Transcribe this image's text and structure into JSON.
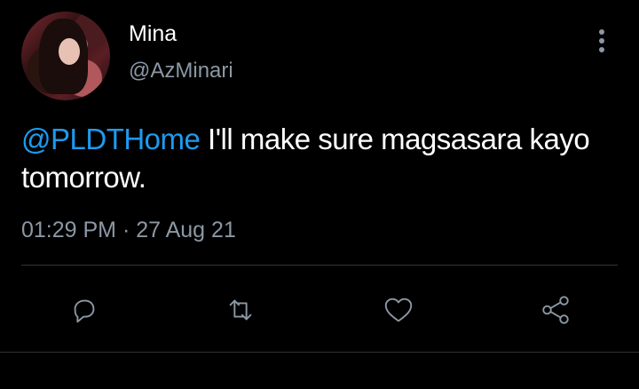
{
  "user": {
    "name": "Mina",
    "handle": "@AzMinari"
  },
  "tweet": {
    "mention": "@PLDTHome",
    "text": " I'll make sure magsasara kayo tomorrow."
  },
  "meta": {
    "time": "01:29 PM",
    "separator": " · ",
    "date": "27 Aug 21"
  },
  "actions": [
    {
      "name": "reply",
      "icon": "reply-icon"
    },
    {
      "name": "retweet",
      "icon": "retweet-icon"
    },
    {
      "name": "like",
      "icon": "heart-icon"
    },
    {
      "name": "share",
      "icon": "share-icon"
    }
  ],
  "colors": {
    "background": "#000000",
    "text": "#ffffff",
    "muted": "#8b98a5",
    "link": "#1d9bf0",
    "divider": "#2f3336"
  }
}
